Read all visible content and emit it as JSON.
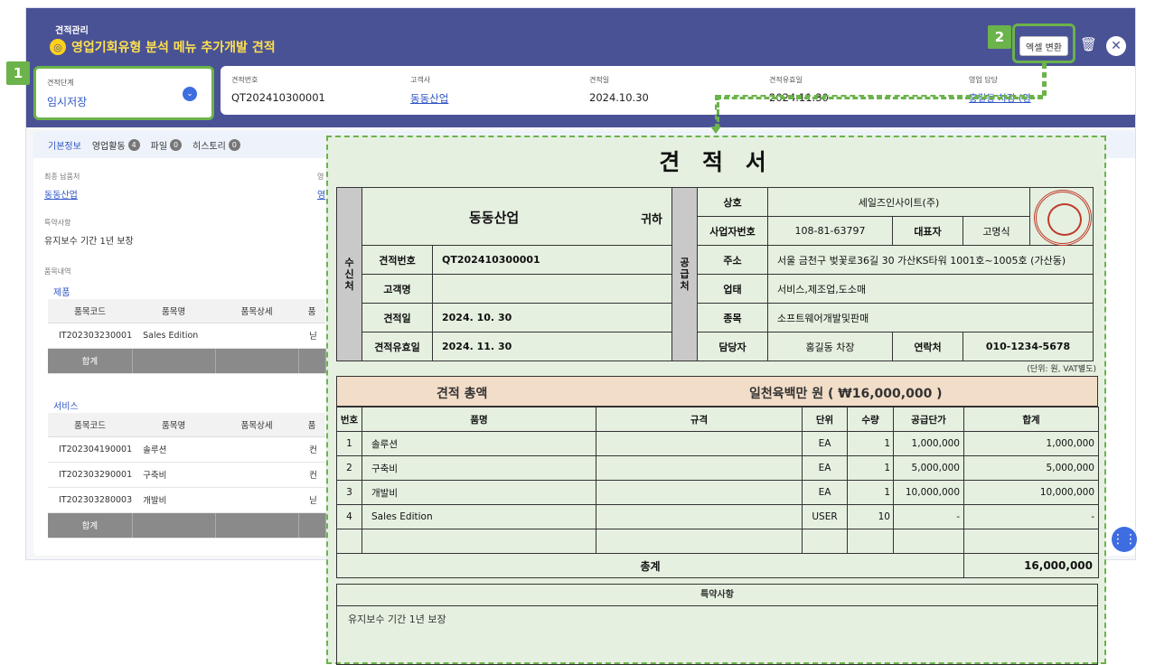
{
  "header": {
    "category": "견적관리",
    "title": "영업기회유형 분석 메뉴 추가개발 견적",
    "excel_label": "엑셀 변환"
  },
  "badges": {
    "one": "1",
    "two": "2"
  },
  "summary": {
    "stage_label": "견적단계",
    "stage_value": "임시저장",
    "no_label": "견적번호",
    "no_value": "QT202410300001",
    "client_label": "고객사",
    "client_value": "동동산업",
    "date_label": "견적일",
    "date_value": "2024.10.30",
    "valid_label": "견적유효일",
    "valid_value": "2024.11.30",
    "owner_label": "영업 담당",
    "owner_value": "홍길동 차장 (영"
  },
  "tabs": [
    {
      "label": "기본정보",
      "count": ""
    },
    {
      "label": "영업활동",
      "count": "4"
    },
    {
      "label": "파일",
      "count": "0"
    },
    {
      "label": "히스토리",
      "count": "0"
    }
  ],
  "info": {
    "final_label": "최종 납품처",
    "final_value": "동동산업",
    "terms_label": "특약사항",
    "terms_value": "유지보수 기간 1년 보장",
    "items_label": "품목내역",
    "cut_label": "영",
    "cut_value": "영"
  },
  "grid_cols": [
    "품목코드",
    "품목명",
    "품목상세",
    "품"
  ],
  "products": {
    "title": "제품",
    "rows": [
      [
        "IT202303230001",
        "Sales Edition",
        "",
        "닏"
      ]
    ],
    "sum": "합계"
  },
  "services": {
    "title": "서비스",
    "rows": [
      [
        "IT202304190001",
        "솔루션",
        "",
        "컨"
      ],
      [
        "IT202303290001",
        "구축비",
        "",
        "컨"
      ],
      [
        "IT202303280003",
        "개발비",
        "",
        "닏"
      ]
    ],
    "sum": "합계"
  },
  "doc": {
    "title": "견 적 서",
    "recipient": "동동산업",
    "honorific": "귀하",
    "recv_side": "수\n신\n처",
    "supp_side": "공\n급\n처",
    "l_no": "견적번호",
    "v_no": "QT202410300001",
    "l_client": "고객명",
    "v_client": "",
    "l_date": "견적일",
    "v_date": "2024. 10. 30",
    "l_valid": "견적유효일",
    "v_valid": "2024. 11. 30",
    "l_company": "상호",
    "v_company": "세일즈인사이트(주)",
    "l_bizno": "사업자번호",
    "v_bizno": "108-81-63797",
    "l_ceo": "대표자",
    "v_ceo": "고명식",
    "l_addr": "주소",
    "v_addr": "서울 금천구 벚꽃로36길 30 가산KS타워 1001호~1005호 (가산동)",
    "l_biz": "업태",
    "v_biz": "서비스,제조업,도소매",
    "l_item": "종목",
    "v_item": "소프트웨어개발및판매",
    "l_mgr": "담당자",
    "v_mgr": "홍길동 차장",
    "l_tel": "연락처",
    "v_tel": "010-1234-5678",
    "unit": "(단위: 원, VAT별도)",
    "total_label": "견적 총액",
    "total_value": "일천육백만 원 ( ₩16,000,000 )",
    "cols": [
      "번호",
      "품명",
      "규격",
      "단위",
      "수량",
      "공급단가",
      "합계"
    ],
    "rows": [
      [
        "1",
        "솔루션",
        "",
        "EA",
        "1",
        "1,000,000",
        "1,000,000"
      ],
      [
        "2",
        "구축비",
        "",
        "EA",
        "1",
        "5,000,000",
        "5,000,000"
      ],
      [
        "3",
        "개발비",
        "",
        "EA",
        "1",
        "10,000,000",
        "10,000,000"
      ],
      [
        "4",
        "Sales Edition",
        "",
        "USER",
        "10",
        "-",
        "-"
      ],
      [
        "",
        "",
        "",
        "",
        "",
        "",
        ""
      ]
    ],
    "sum_label": "총계",
    "sum_value": "16,000,000",
    "notes_title": "특약사항",
    "notes_text": "유지보수 기간 1년 보장"
  }
}
